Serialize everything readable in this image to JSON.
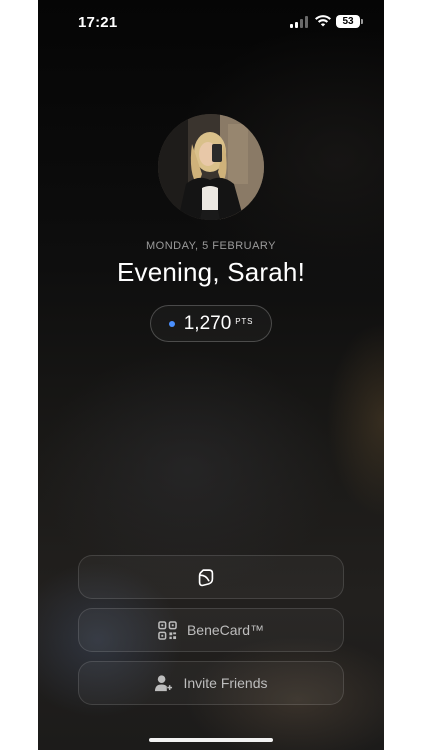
{
  "status_bar": {
    "time": "17:21",
    "battery": "53"
  },
  "profile": {
    "date": "MONDAY, 5 FEBRUARY",
    "greeting": "Evening, Sarah!",
    "avatar_icon": "profile-photo"
  },
  "points": {
    "value": "1,270",
    "unit": "PTS",
    "dot_color": "#4a90ff"
  },
  "actions": {
    "logo_icon": "bene-logo-icon",
    "card_label": "BeneCard™",
    "card_icon": "qr-code-icon",
    "invite_label": "Invite Friends",
    "invite_icon": "add-person-icon"
  }
}
